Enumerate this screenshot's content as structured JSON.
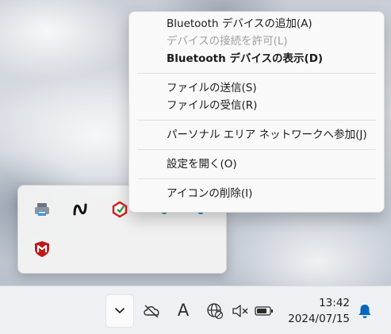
{
  "context_menu": {
    "items": [
      {
        "label": "Bluetooth デバイスの追加(A)",
        "enabled": true,
        "bold": false
      },
      {
        "label": "デバイスの接続を許可(L)",
        "enabled": false,
        "bold": false
      },
      {
        "label": "Bluetooth デバイスの表示(D)",
        "enabled": true,
        "bold": true
      },
      {
        "label": "ファイルの送信(S)",
        "enabled": true,
        "bold": false
      },
      {
        "label": "ファイルの受信(R)",
        "enabled": true,
        "bold": false
      },
      {
        "label": "パーソナル エリア ネットワークへ参加(J)",
        "enabled": true,
        "bold": false
      },
      {
        "label": "設定を開く(O)",
        "enabled": true,
        "bold": false
      },
      {
        "label": "アイコンの削除(I)",
        "enabled": true,
        "bold": false
      }
    ]
  },
  "tray_flyout": {
    "icons": [
      "printer-icon",
      "app-n-icon",
      "security-app-icon",
      "mcafee-icon"
    ]
  },
  "taskbar": {
    "icons": [
      "chevron-up-icon",
      "onedrive-offline-icon",
      "ime-mode-icon",
      "network-globe-icon",
      "volume-muted-icon",
      "battery-icon",
      "notification-bell-icon"
    ],
    "ime_label": "A",
    "clock": {
      "time": "13:42",
      "date": "2024/07/15"
    }
  },
  "colors": {
    "accent": "#0067c0",
    "mcafee_red": "#c01818",
    "menu_bg": "#f9f9f9",
    "taskbar_bg": "#eef0f4"
  }
}
